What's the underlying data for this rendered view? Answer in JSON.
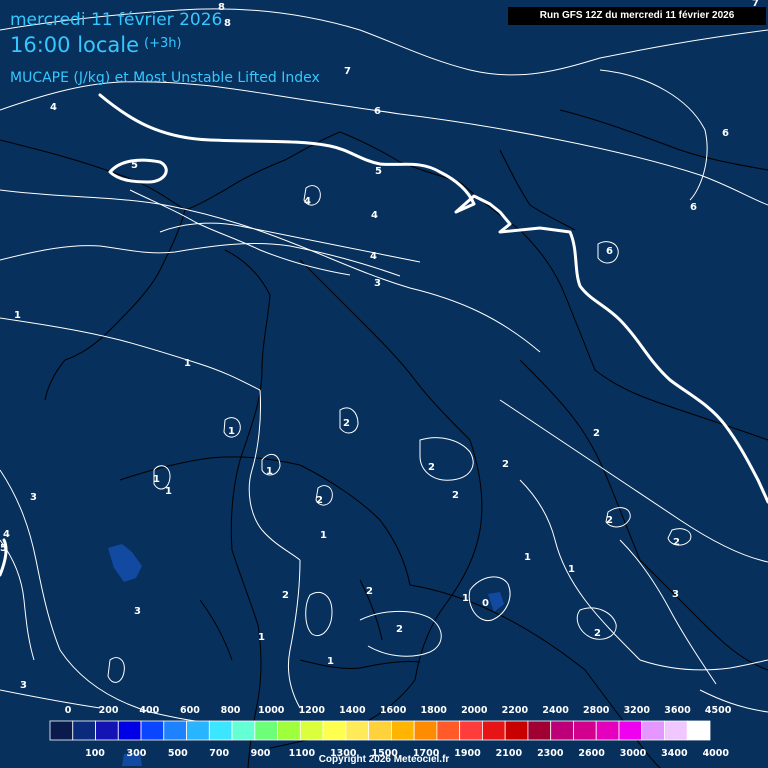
{
  "header": {
    "date": "mercredi 11 février 2026",
    "time": "16:00 locale",
    "offset": "(+3h)",
    "parameter": "MUCAPE (J/kg) et Most Unstable Lifted Index",
    "run": "Run GFS 12Z du mercredi 11 février 2026"
  },
  "copyright": "Copyright 2026 Meteociel.fr",
  "colors": {
    "background": "#07305c",
    "contour": "#ffffff",
    "border": "#000000",
    "title": "#35c8ff",
    "patch": "#114aa0"
  },
  "contour_labels": [
    "8",
    "8",
    "7",
    "7",
    "4",
    "6",
    "6",
    "5",
    "5",
    "4",
    "4",
    "6",
    "6",
    "4",
    "3",
    "1",
    "1",
    "1",
    "2",
    "1",
    "1",
    "1",
    "2",
    "2",
    "2",
    "2",
    "3",
    "4",
    "5",
    "2",
    "1",
    "1",
    "2",
    "1",
    "2",
    "0",
    "1",
    "2",
    "2",
    "1",
    "3",
    "3",
    "1",
    "3",
    "2",
    "2"
  ],
  "legend": {
    "top_labels": [
      "0",
      "200",
      "400",
      "600",
      "800",
      "1000",
      "1200",
      "1400",
      "1600",
      "1800",
      "2000",
      "2200",
      "2400",
      "2800",
      "3200",
      "3600",
      "4500"
    ],
    "bottom_labels": [
      "100",
      "300",
      "500",
      "700",
      "900",
      "1100",
      "1300",
      "1500",
      "1700",
      "1900",
      "2100",
      "2300",
      "2600",
      "3000",
      "3400",
      "4000"
    ],
    "swatches": [
      "#0b1a4d",
      "#0a2a7c",
      "#1414b4",
      "#0000e6",
      "#0a46ff",
      "#1e82ff",
      "#28b4ff",
      "#3ce6ff",
      "#64ffd2",
      "#6eff78",
      "#a0ff3c",
      "#dcff3c",
      "#ffff50",
      "#ffeb5a",
      "#ffd23c",
      "#ffb400",
      "#ff8c00",
      "#ff5a28",
      "#ff3c3c",
      "#e61414",
      "#c80000",
      "#a00032",
      "#be0078",
      "#d2008c",
      "#e600be",
      "#f000f0",
      "#e696ff",
      "#f0c8ff",
      "#ffffff"
    ]
  }
}
